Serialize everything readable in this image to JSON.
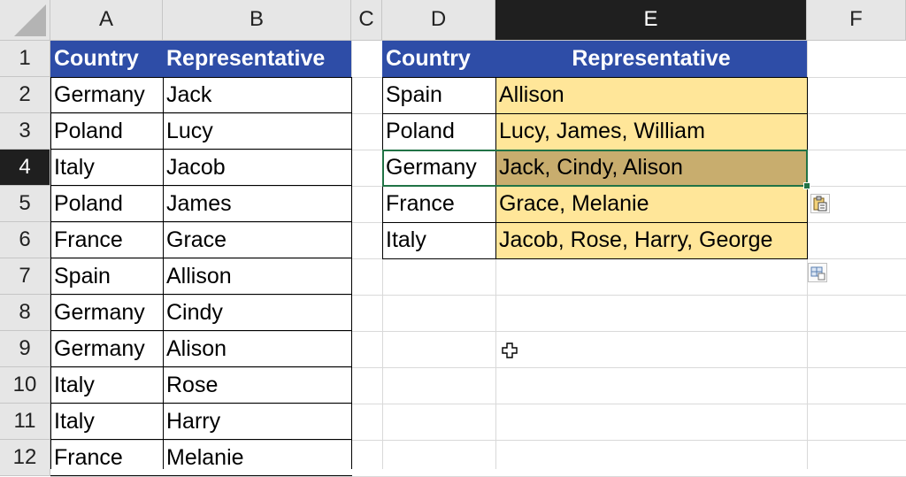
{
  "columns": [
    "A",
    "B",
    "C",
    "D",
    "E",
    "F"
  ],
  "rows": [
    "1",
    "2",
    "3",
    "4",
    "5",
    "6",
    "7",
    "8",
    "9",
    "10",
    "11",
    "12"
  ],
  "selected_column": "E",
  "selected_row": "4",
  "source_table": {
    "headers": [
      "Country",
      "Representative"
    ],
    "rows": [
      [
        "Germany",
        "Jack"
      ],
      [
        "Poland",
        "Lucy"
      ],
      [
        "Italy",
        "Jacob"
      ],
      [
        "Poland",
        "James"
      ],
      [
        "France",
        "Grace"
      ],
      [
        "Spain",
        "Allison"
      ],
      [
        "Germany",
        "Cindy"
      ],
      [
        "Germany",
        "Alison"
      ],
      [
        "Italy",
        "Rose"
      ],
      [
        "Italy",
        "Harry"
      ],
      [
        "France",
        "Melanie"
      ]
    ]
  },
  "result_table": {
    "headers": [
      "Country",
      "Representative"
    ],
    "rows": [
      [
        "Spain",
        "Allison"
      ],
      [
        "Poland",
        "Lucy, James, William"
      ],
      [
        "Germany",
        "Jack, Cindy, Alison"
      ],
      [
        "France",
        "Grace, Melanie"
      ],
      [
        "Italy",
        "Jacob, Rose, Harry, George"
      ]
    ]
  },
  "colors": {
    "header_fill": "#2e4da7",
    "result_fill": "#ffe699",
    "selected_fill": "#c8ad6e",
    "selection_border": "#217346"
  },
  "icons": [
    "select-all-icon",
    "paste-options-icon",
    "quick-analysis-icon",
    "cell-cursor-icon"
  ]
}
